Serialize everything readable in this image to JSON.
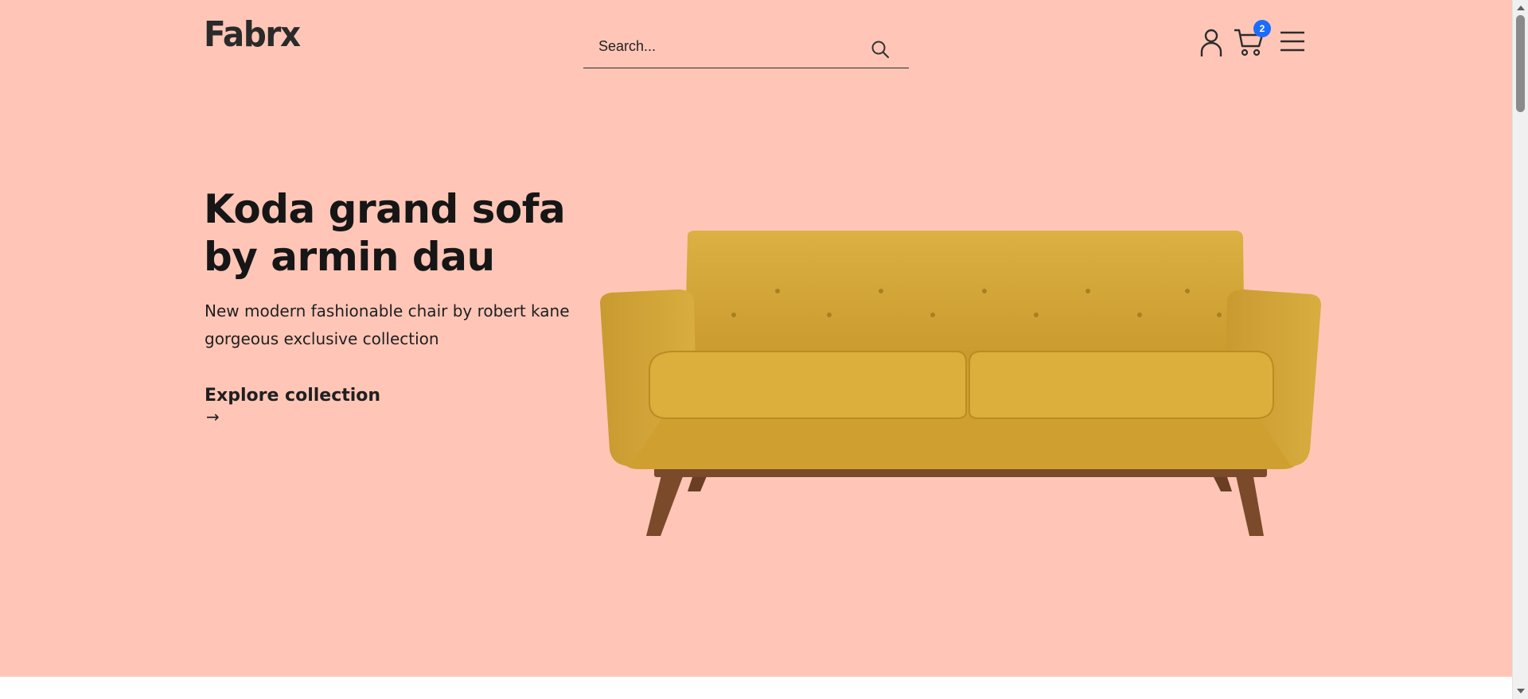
{
  "header": {
    "logo": "Fabrx",
    "search": {
      "placeholder": "Search...",
      "value": ""
    },
    "icons": [
      "user-icon",
      "cart-icon",
      "menu-icon"
    ],
    "cart_count": "2"
  },
  "hero": {
    "title_line1": "Koda grand sofa",
    "title_line2": "by armin dau",
    "description_line1": "New modern fashionable chair by robert kane",
    "description_line2": "gorgeous exclusive collection",
    "cta_label": "Explore collection",
    "cta_arrow": "→",
    "image": "yellow-sofa-image"
  },
  "colors": {
    "hero_background": "#ffc6b7",
    "badge": "#1a6cff",
    "sofa_fabric": "#d4a73a",
    "sofa_wood": "#7a4a2b"
  }
}
